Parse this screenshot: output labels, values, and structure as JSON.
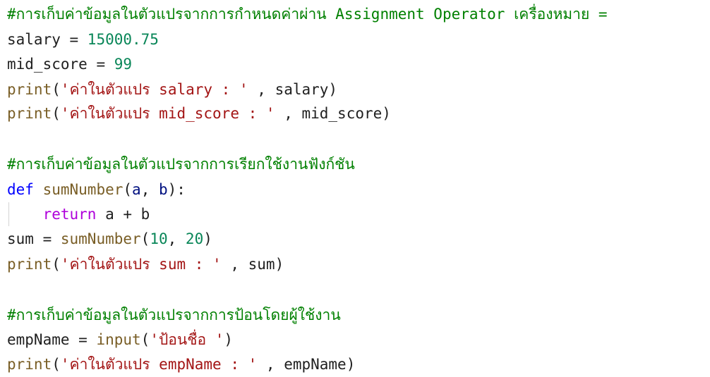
{
  "colors": {
    "comment": "#008000",
    "number": "#098658",
    "builtin": "#795e26",
    "string": "#a31515",
    "keyword": "#0000ff",
    "flow_keyword": "#af00db",
    "parameter": "#001080",
    "text": "#1f1f1f",
    "background": "#ffffff"
  },
  "code": {
    "line1": {
      "comment": "#การเก็บค่าข้อมูลในตัวแปรจากการกำหนดค่าผ่าน Assignment Operator เครื่องหมาย ="
    },
    "line2": {
      "var": "salary",
      "op": " = ",
      "number": "15000.75"
    },
    "line3": {
      "var": "mid_score",
      "op": " = ",
      "number": "99"
    },
    "line4": {
      "func": "print",
      "open": "(",
      "string": "'ค่าในตัวแปร salary : '",
      "sep": " , ",
      "arg": "salary",
      "close": ")"
    },
    "line5": {
      "func": "print",
      "open": "(",
      "string": "'ค่าในตัวแปร mid_score : '",
      "sep": " , ",
      "arg": "mid_score",
      "close": ")"
    },
    "line6": {
      "comment": "#การเก็บค่าข้อมูลในตัวแปรจากการเรียกใช้งานฟังก์ชัน"
    },
    "line7": {
      "keyword": "def",
      "space": " ",
      "func": "sumNumber",
      "open": "(",
      "param1": "a",
      "comma": ", ",
      "param2": "b",
      "close": "):"
    },
    "line8": {
      "indent": "    ",
      "keyword": "return",
      "expr": " a + b"
    },
    "line9": {
      "var": "sum",
      "op": " = ",
      "func": "sumNumber",
      "open": "(",
      "num1": "10",
      "comma": ", ",
      "num2": "20",
      "close": ")"
    },
    "line10": {
      "func": "print",
      "open": "(",
      "string": "'ค่าในตัวแปร sum : '",
      "sep": " , ",
      "arg": "sum",
      "close": ")"
    },
    "line11": {
      "comment": "#การเก็บค่าข้อมูลในตัวแปรจากการป้อนโดยผู้ใช้งาน"
    },
    "line12": {
      "var": "empName",
      "op": " = ",
      "func": "input",
      "open": "(",
      "string": "'ป้อนชื่อ '",
      "close": ")"
    },
    "line13": {
      "func": "print",
      "open": "(",
      "string": "'ค่าในตัวแปร empName : '",
      "sep": " , ",
      "arg": "empName",
      "close": ")"
    }
  }
}
